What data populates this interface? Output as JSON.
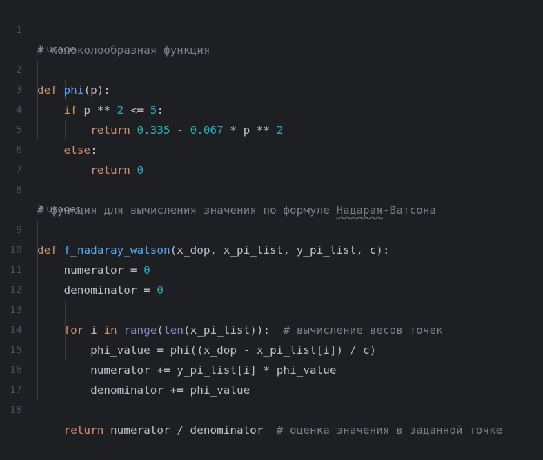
{
  "lines": {
    "l1": {
      "num": "1",
      "comment": "# колоколообразная функция"
    },
    "h1": {
      "text": "1 usage"
    },
    "l2": {
      "num": "2",
      "def": "def",
      "name": "phi",
      "rest": "(p):"
    },
    "l3": {
      "num": "3",
      "if": "if",
      "a": " p ** ",
      "n1": "2",
      "b": " <= ",
      "n2": "5",
      "c": ":"
    },
    "l4": {
      "num": "4",
      "ret": "return",
      "n1": "0.335",
      "a": " - ",
      "n2": "0.067",
      "b": " * p ** ",
      "n3": "2"
    },
    "l5": {
      "num": "5",
      "else": "else",
      "c": ":"
    },
    "l6": {
      "num": "6",
      "ret": "return",
      "n1": "0"
    },
    "l7": {
      "num": "7"
    },
    "l8": {
      "num": "8",
      "c1": "# функция для вычисления значения по формуле ",
      "typo": "Надарая",
      "c2": "-Ватсона"
    },
    "h2": {
      "text": "2 usages"
    },
    "l9": {
      "num": "9",
      "def": "def",
      "name": "f_nadaray_watson",
      "rest": "(x_dop, x_pi_list, y_pi_list, c):"
    },
    "l10": {
      "num": "10",
      "a": "numerator = ",
      "n1": "0"
    },
    "l11": {
      "num": "11",
      "a": "denominator = ",
      "n1": "0"
    },
    "l12": {
      "num": "12"
    },
    "l13": {
      "num": "13",
      "for": "for",
      "a": " i ",
      "in": "in",
      "b": " ",
      "range": "range",
      "p1": "(",
      "len": "len",
      "c": "(x_pi_list)):  ",
      "comment": "# вычисление весов точек"
    },
    "l14": {
      "num": "14",
      "a": "phi_value = phi((x_dop - x_pi_list[i]) / c)"
    },
    "l15": {
      "num": "15",
      "a": "numerator += y_pi_list[i] * phi_value"
    },
    "l16": {
      "num": "16",
      "a": "denominator += phi_value"
    },
    "l17": {
      "num": "17"
    },
    "l18": {
      "num": "18",
      "ret": "return",
      "a": " numerator / denominator  ",
      "comment": "# оценка значения в заданной точке"
    }
  },
  "colors": {
    "background": "#1e1f22",
    "keyword": "#cf8e6d",
    "function": "#56a8f5",
    "number": "#2aacb8",
    "comment": "#7a7e85",
    "builtin": "#8888c6",
    "line_number": "#4b5059"
  }
}
